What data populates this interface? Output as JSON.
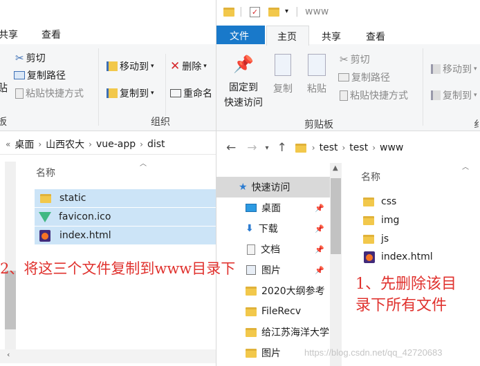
{
  "left": {
    "tabs": [
      "共享",
      "查看"
    ],
    "clipboard": {
      "cut": "剪切",
      "copy_path": "复制路径",
      "paste_shortcut": "粘贴快捷方式",
      "paste_partial": "贴",
      "group_partial": "板"
    },
    "organize": {
      "move_to": "移动到",
      "copy_to": "复制到",
      "delete": "删除",
      "rename": "重命名",
      "group": "组织"
    },
    "breadcrumb": [
      "桌面",
      "山西农大",
      "vue-app",
      "dist"
    ],
    "column_header": "名称",
    "files": [
      {
        "name": "static",
        "icon": "folder-icon"
      },
      {
        "name": "favicon.ico",
        "icon": "vue-logo-icon"
      },
      {
        "name": "index.html",
        "icon": "firefox-icon"
      }
    ]
  },
  "right": {
    "title": "www",
    "tabs": [
      "文件",
      "主页",
      "共享",
      "查看"
    ],
    "clipboard": {
      "pin": "固定到",
      "pin2": "快速访问",
      "copy": "复制",
      "paste": "粘贴",
      "cut": "剪切",
      "copy_path": "复制路径",
      "paste_shortcut": "粘贴快捷方式",
      "group": "剪贴板"
    },
    "organize": {
      "move_to": "移动到",
      "copy_to": "复制到",
      "group_partial": "纟"
    },
    "breadcrumb": [
      "test",
      "test",
      "www"
    ],
    "nav": [
      {
        "label": "快速访问",
        "pinned": false
      },
      {
        "label": "桌面",
        "pinned": true
      },
      {
        "label": "下载",
        "pinned": true
      },
      {
        "label": "文档",
        "pinned": true
      },
      {
        "label": "图片",
        "pinned": true
      },
      {
        "label": "2020大纲参考",
        "pinned": false
      },
      {
        "label": "FileRecv",
        "pinned": false
      },
      {
        "label": "给江苏海洋大学",
        "pinned": false
      },
      {
        "label": "图片",
        "pinned": false
      }
    ],
    "column_header": "名称",
    "files": [
      {
        "name": "css",
        "icon": "folder-icon"
      },
      {
        "name": "img",
        "icon": "folder-icon"
      },
      {
        "name": "js",
        "icon": "folder-icon"
      },
      {
        "name": "index.html",
        "icon": "firefox-icon"
      }
    ]
  },
  "annotations": {
    "left": "2、将这三个文件复制到www目录下",
    "right_line1": "1、先删除该目",
    "right_line2": "录下所有文件"
  },
  "watermark": "https://blog.csdn.net/qq_42720683"
}
